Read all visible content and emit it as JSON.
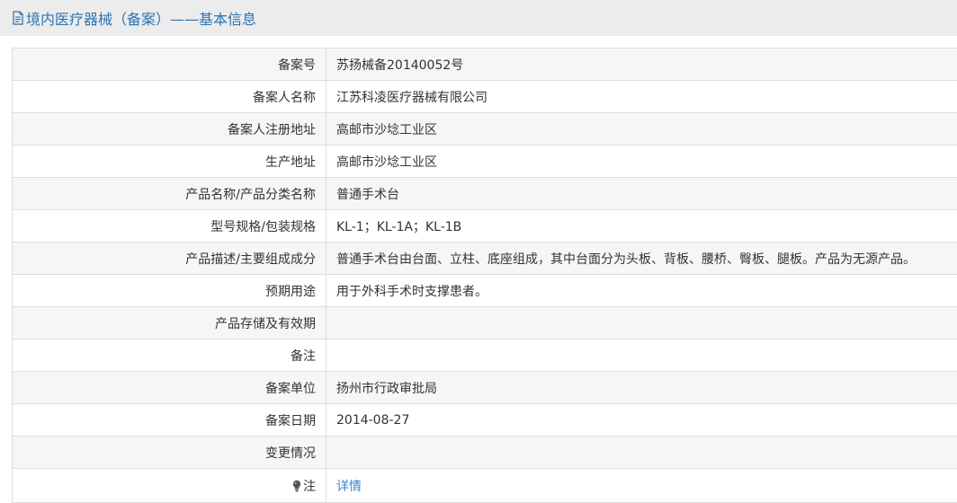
{
  "header": {
    "title": "境内医疗器械（备案）——基本信息",
    "icon": "document-icon",
    "color": "#2a74b3"
  },
  "rows": [
    {
      "label": "备案号",
      "value": "苏扬械备20140052号"
    },
    {
      "label": "备案人名称",
      "value": "江苏科凌医疗器械有限公司"
    },
    {
      "label": "备案人注册地址",
      "value": "高邮市沙埝工业区"
    },
    {
      "label": "生产地址",
      "value": "高邮市沙埝工业区"
    },
    {
      "label": "产品名称/产品分类名称",
      "value": "普通手术台"
    },
    {
      "label": "型号规格/包装规格",
      "value": "KL-1；KL-1A；KL-1B"
    },
    {
      "label": "产品描述/主要组成成分",
      "value": "普通手术台由台面、立柱、底座组成，其中台面分为头板、背板、腰桥、臀板、腿板。产品为无源产品。"
    },
    {
      "label": "预期用途",
      "value": "用于外科手术时支撑患者。"
    },
    {
      "label": "产品存储及有效期",
      "value": ""
    },
    {
      "label": "备注",
      "value": ""
    },
    {
      "label": "备案单位",
      "value": "扬州市行政审批局"
    },
    {
      "label": "备案日期",
      "value": "2014-08-27"
    },
    {
      "label": "变更情况",
      "value": ""
    }
  ],
  "note_row": {
    "label": "注",
    "icon": "lightbulb-icon",
    "link_text": "详情",
    "link_color": "#3a86c8"
  }
}
